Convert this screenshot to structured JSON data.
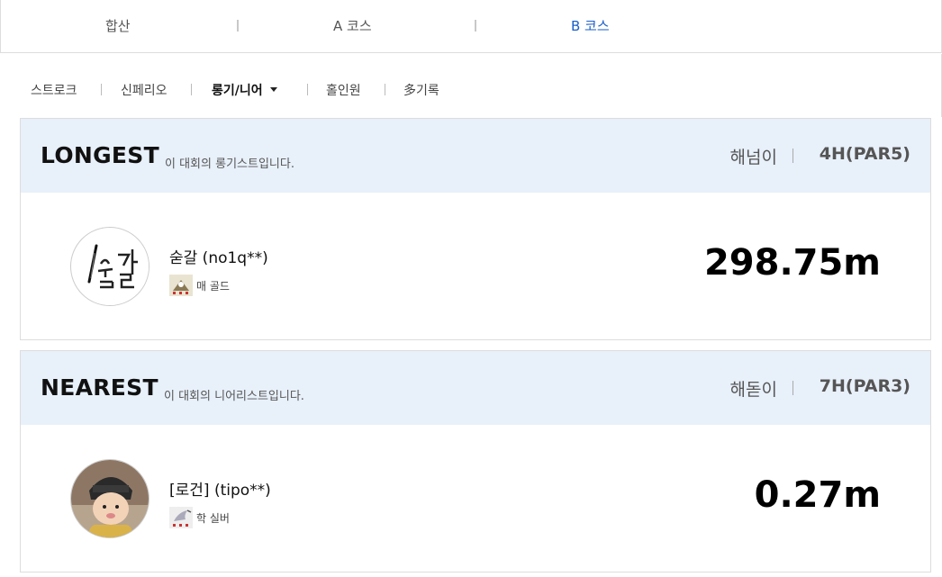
{
  "course_tabs": [
    {
      "label": "합산",
      "active": false
    },
    {
      "label": "A 코스",
      "active": false
    },
    {
      "label": "B 코스",
      "active": true
    }
  ],
  "sub_tabs": [
    {
      "label": "스트로크",
      "active": false
    },
    {
      "label": "신페리오",
      "active": false
    },
    {
      "label": "롱기/니어",
      "active": true,
      "has_dropdown": true
    },
    {
      "label": "홀인원",
      "active": false
    },
    {
      "label": "多기록",
      "active": false
    }
  ],
  "cards": [
    {
      "title": "LONGEST",
      "subtitle": "이 대회의 롱기스트입니다.",
      "hole_name": "해넘이",
      "hole_par": "4H(PAR5)",
      "player": {
        "name": "숟갈 (no1q**)",
        "grade": "매 골드",
        "avatar": "calligraphy-logo"
      },
      "record": "298.75m"
    },
    {
      "title": "NEAREST",
      "subtitle": "이 대회의 니어리스트입니다.",
      "hole_name": "해돋이",
      "hole_par": "7H(PAR3)",
      "player": {
        "name": "[로건] (tipo**)",
        "grade": "학 실버",
        "avatar": "child-photo"
      },
      "record": "0.27m"
    }
  ],
  "colors": {
    "accent": "#1a5fc9",
    "card_header_bg": "#e8f0fa"
  }
}
